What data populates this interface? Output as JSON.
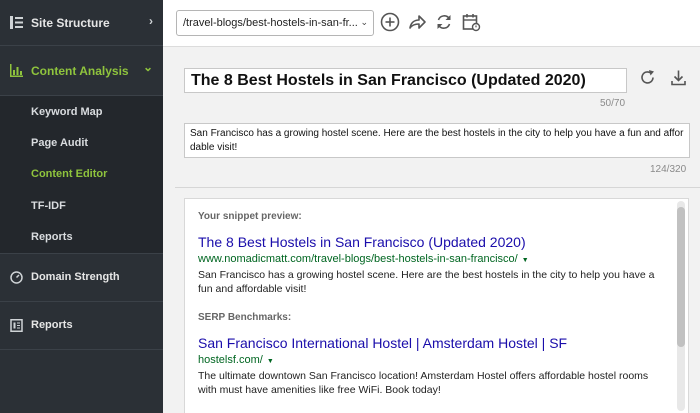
{
  "sidebar": {
    "site_structure": "Site Structure",
    "content_analysis": "Content Analysis",
    "sub_items": [
      {
        "label": "Keyword Map"
      },
      {
        "label": "Page Audit"
      },
      {
        "label": "Content Editor"
      },
      {
        "label": "TF-IDF"
      },
      {
        "label": "Reports"
      }
    ],
    "domain_strength": "Domain Strength",
    "reports": "Reports"
  },
  "toolbar": {
    "url_value": "/travel-blogs/best-hostels-in-san-fr...",
    "icons": [
      "add-icon",
      "share-icon",
      "refresh-icon",
      "schedule-icon"
    ]
  },
  "editor": {
    "title_value": "The 8 Best Hostels in San Francisco (Updated 2020)",
    "title_counter": "50/70",
    "description_value": "San Francisco has a growing hostel scene. Here are the best hostels in the city to help you have a fun and affordable visit!",
    "description_counter": "124/320"
  },
  "preview": {
    "snippet_label": "Your snippet preview:",
    "snippet": {
      "title": "The 8 Best Hostels in San Francisco (Updated 2020)",
      "url": "www.nomadicmatt.com/travel-blogs/best-hostels-in-san-francisco/",
      "description": "San Francisco has a growing hostel scene. Here are the best hostels in the city to help you have a fun and affordable visit!"
    },
    "benchmarks_label": "SERP Benchmarks:",
    "benchmarks": [
      {
        "title": "San Francisco International Hostel | Amsterdam Hostel | SF",
        "url": "hostelsf.com/",
        "description": "The ultimate downtown San Francisco location! Amsterdam Hostel offers affordable hostel rooms with must have amenities like free WiFi. Book today!"
      }
    ]
  },
  "colors": {
    "sidebar_bg": "#2b3036",
    "accent_green": "#8fc43d",
    "link_blue": "#1a0dab",
    "url_green": "#006621"
  }
}
